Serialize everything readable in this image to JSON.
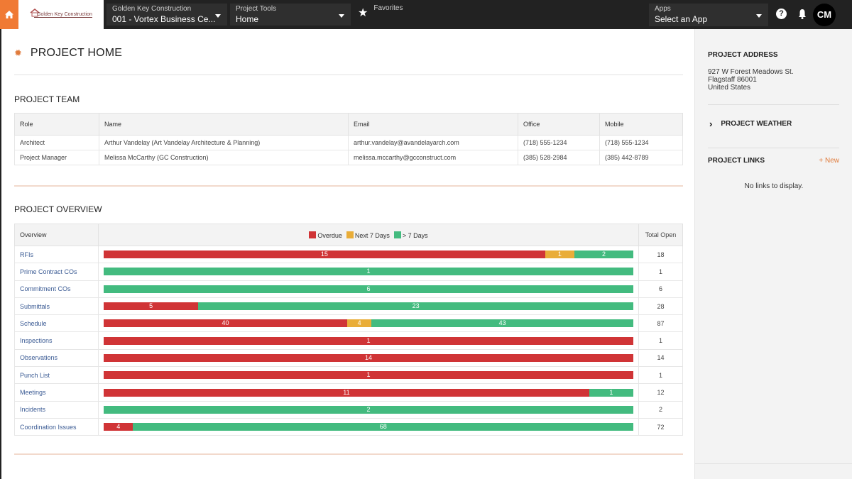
{
  "topbar": {
    "home_icon": "home-icon",
    "logo_text": "Golden Key Construction",
    "project_selector": {
      "label": "Golden Key Construction",
      "value": "001 - Vortex Business Ce..."
    },
    "tools_selector": {
      "label": "Project Tools",
      "value": "Home"
    },
    "favorites": {
      "label": "Favorites",
      "icon": "star-icon"
    },
    "apps_selector": {
      "label": "Apps",
      "value": "Select an App"
    },
    "help_icon": "?",
    "avatar_initials": "CM"
  },
  "page": {
    "title": "PROJECT HOME",
    "icon": "gear-icon"
  },
  "team": {
    "title": "PROJECT TEAM",
    "columns": [
      "Role",
      "Name",
      "Email",
      "Office",
      "Mobile"
    ],
    "rows": [
      [
        "Architect",
        "Arthur Vandelay (Art Vandelay Architecture & Planning)",
        "arthur.vandelay@avandelayarch.com",
        "(718) 555-1234",
        "(718) 555-1234"
      ],
      [
        "Project Manager",
        "Melissa McCarthy (GC Construction)",
        "melissa.mccarthy@gcconstruct.com",
        "(385) 528-2984",
        "(385) 442-8789"
      ]
    ]
  },
  "overview": {
    "title": "PROJECT OVERVIEW",
    "col_overview": "Overview",
    "col_total": "Total Open",
    "legend": [
      {
        "label": "Overdue",
        "color": "#d03436"
      },
      {
        "label": "Next 7 Days",
        "color": "#e9ad38"
      },
      {
        "label": "> 7 Days",
        "color": "#43bb7f"
      }
    ]
  },
  "chart_data": {
    "type": "bar",
    "stacked": true,
    "orientation": "horizontal",
    "categories": [
      "RFIs",
      "Prime Contract COs",
      "Commitment COs",
      "Submittals",
      "Schedule",
      "Inspections",
      "Observations",
      "Punch List",
      "Meetings",
      "Incidents",
      "Coordination Issues"
    ],
    "series": [
      {
        "name": "Overdue",
        "color": "#d03436",
        "values": [
          15,
          0,
          0,
          5,
          40,
          1,
          14,
          1,
          11,
          0,
          4
        ]
      },
      {
        "name": "Next 7 Days",
        "color": "#e9ad38",
        "values": [
          1,
          0,
          0,
          0,
          4,
          0,
          0,
          0,
          0,
          0,
          0
        ]
      },
      {
        "name": "> 7 Days",
        "color": "#43bb7f",
        "values": [
          2,
          1,
          6,
          23,
          43,
          0,
          0,
          0,
          1,
          2,
          68
        ]
      }
    ],
    "totals": [
      18,
      1,
      6,
      28,
      87,
      1,
      14,
      1,
      12,
      2,
      72
    ],
    "legend_position": "top-center"
  },
  "sidebar": {
    "address_title": "PROJECT ADDRESS",
    "address_lines": [
      "927 W Forest Meadows St.",
      "Flagstaff 86001",
      "United States"
    ],
    "weather_title": "PROJECT WEATHER",
    "links_title": "PROJECT LINKS",
    "new_link_label": "+ New",
    "no_links_text": "No links to display."
  }
}
